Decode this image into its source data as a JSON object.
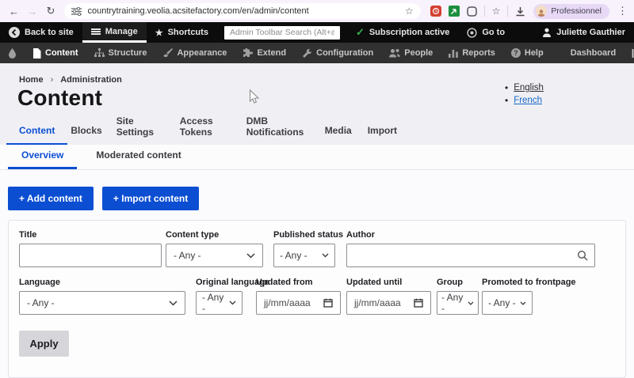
{
  "browser": {
    "url": "countrytraining.veolia.acsitefactory.com/en/admin/content",
    "profile": "Professionnel"
  },
  "toolbar": {
    "back_to_site": "Back to site",
    "manage": "Manage",
    "shortcuts": "Shortcuts",
    "search_placeholder": "Admin Toolbar Search (Alt+a)",
    "subscription": "Subscription active",
    "go_to": "Go to",
    "user_name": "Juliette Gauthier"
  },
  "admin_menu": {
    "items": [
      {
        "label": "Content"
      },
      {
        "label": "Structure"
      },
      {
        "label": "Appearance"
      },
      {
        "label": "Extend"
      },
      {
        "label": "Configuration"
      },
      {
        "label": "People"
      },
      {
        "label": "Reports"
      },
      {
        "label": "Help"
      },
      {
        "label": "Dashboard"
      }
    ]
  },
  "breadcrumb": {
    "home": "Home",
    "current": "Administration"
  },
  "page": {
    "title": "Content"
  },
  "languages": {
    "english": "English",
    "french": "French"
  },
  "tabs": [
    {
      "label": "Content",
      "active": true
    },
    {
      "label": "Blocks",
      "active": false
    },
    {
      "label": "Site Settings",
      "active": false
    },
    {
      "label": "Access Tokens",
      "active": false
    },
    {
      "label": "DMB Notifications",
      "active": false
    },
    {
      "label": "Media",
      "active": false
    },
    {
      "label": "Import",
      "active": false
    }
  ],
  "subtabs": [
    {
      "label": "Overview",
      "active": true
    },
    {
      "label": "Moderated content",
      "active": false
    }
  ],
  "actions": {
    "add": "+ Add content",
    "import": "+ Import content"
  },
  "filters": {
    "title": {
      "label": "Title",
      "value": ""
    },
    "content_type": {
      "label": "Content type",
      "value": "- Any -"
    },
    "published_status": {
      "label": "Published status",
      "value": "- Any -"
    },
    "author": {
      "label": "Author",
      "value": ""
    },
    "language": {
      "label": "Language",
      "value": "- Any -"
    },
    "original_language": {
      "label": "Original language",
      "value": "- Any -"
    },
    "updated_from": {
      "label": "Updated from",
      "placeholder": "jj/mm/aaaa"
    },
    "updated_until": {
      "label": "Updated until",
      "placeholder": "jj/mm/aaaa"
    },
    "group": {
      "label": "Group",
      "value": "- Any -"
    },
    "promoted": {
      "label": "Promoted to frontpage",
      "value": "- Any -"
    },
    "apply": "Apply"
  },
  "icons": {
    "back": "←",
    "forward": "→",
    "refresh": "↻",
    "bookmark_star": "☆",
    "sparkle_star": "☆",
    "menu_dots": "⋮",
    "shortcuts_star": "★",
    "check": "✓",
    "breadcrumb_separator": "›",
    "bullet": "•",
    "question": "?"
  },
  "colors": {
    "accent_blue": "#0b4ed2",
    "toolbar_black": "#0c0c0c",
    "toolbar_gray": "#313131",
    "success_green": "#35b24a",
    "header_bg": "#f0f0f4"
  }
}
